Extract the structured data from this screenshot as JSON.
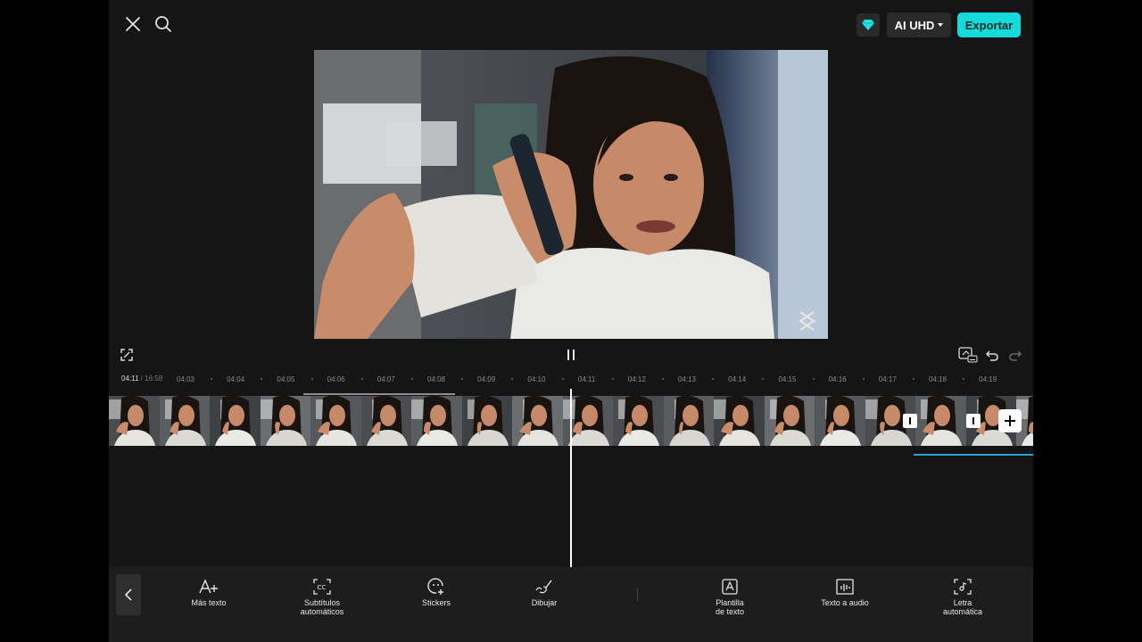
{
  "header": {
    "close_icon": "close-icon",
    "search_icon": "search-icon",
    "premium_icon": "diamond-icon",
    "quality_label": "AI UHD",
    "export_label": "Exportar",
    "accent_color": "#16d9d9"
  },
  "player": {
    "fullscreen_icon": "fullscreen-icon",
    "pause_icon": "pause-icon",
    "captions_icon": "captions-on-icon",
    "undo_icon": "undo-icon",
    "redo_icon": "redo-icon",
    "watermark_icon": "capcut-logo-icon"
  },
  "timeline": {
    "current_time": "04:11",
    "separator": "/",
    "total_time": "16:58",
    "ticks": [
      "04:03",
      "04:04",
      "04:05",
      "04:06",
      "04:07",
      "04:08",
      "04:09",
      "04:10",
      "04:11",
      "04:12",
      "04:13",
      "04:14",
      "04:15",
      "04:16",
      "04:17",
      "04:18",
      "04:19"
    ],
    "add_clip_icon": "plus-icon"
  },
  "toolbar": {
    "back_icon": "chevron-left-icon",
    "items": [
      {
        "label": "Más texto",
        "icon": "add-text-icon"
      },
      {
        "label": "Subtítulos\nautomáticos",
        "icon": "auto-captions-icon"
      },
      {
        "label": "Stickers",
        "icon": "sticker-icon"
      },
      {
        "label": "Dibujar",
        "icon": "draw-brush-icon"
      },
      {
        "label": "Plantilla\nde texto",
        "icon": "text-template-icon"
      },
      {
        "label": "Texto a audio",
        "icon": "text-to-audio-icon"
      },
      {
        "label": "Letra\nautomática",
        "icon": "auto-lyrics-icon"
      }
    ]
  }
}
